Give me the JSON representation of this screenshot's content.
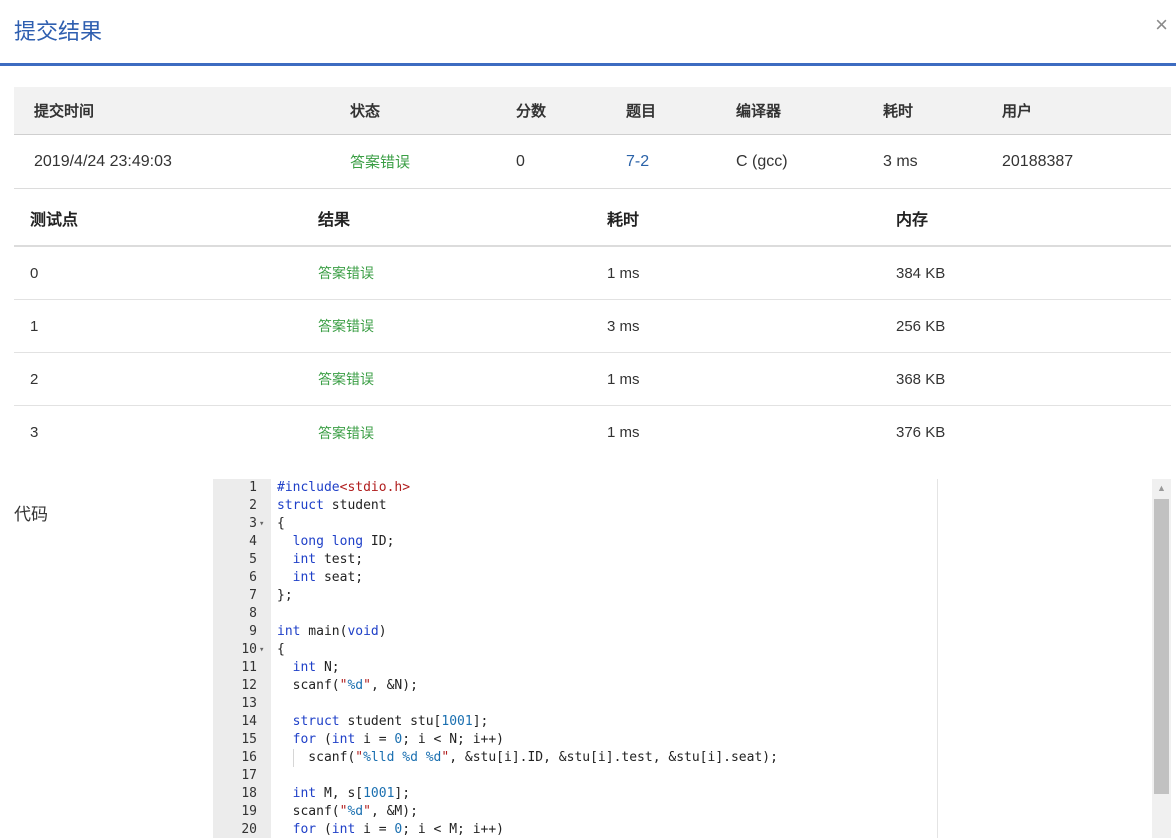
{
  "dialog": {
    "title": "提交结果",
    "close_symbol": "×"
  },
  "summary": {
    "headers": [
      "提交时间",
      "状态",
      "分数",
      "题目",
      "编译器",
      "耗时",
      "用户"
    ],
    "row": {
      "submit_time": "2019/4/24 23:49:03",
      "status": "答案错误",
      "score": "0",
      "problem": "7-2",
      "compiler": "C (gcc)",
      "time": "3 ms",
      "user": "20188387"
    }
  },
  "testcases": {
    "headers": [
      "测试点",
      "结果",
      "耗时",
      "内存"
    ],
    "rows": [
      {
        "id": "0",
        "result": "答案错误",
        "time": "1 ms",
        "memory": "384 KB"
      },
      {
        "id": "1",
        "result": "答案错误",
        "time": "3 ms",
        "memory": "256 KB"
      },
      {
        "id": "2",
        "result": "答案错误",
        "time": "1 ms",
        "memory": "368 KB"
      },
      {
        "id": "3",
        "result": "答案错误",
        "time": "1 ms",
        "memory": "376 KB"
      }
    ]
  },
  "code": {
    "label": "代码",
    "lines": [
      {
        "n": "1",
        "fold": "",
        "guide": false,
        "tokens": [
          {
            "t": "#include",
            "c": "kw"
          },
          {
            "t": "<stdio.h>",
            "c": "str"
          }
        ]
      },
      {
        "n": "2",
        "fold": "",
        "guide": false,
        "tokens": [
          {
            "t": "struct",
            "c": "kw"
          },
          {
            "t": " student",
            "c": ""
          }
        ]
      },
      {
        "n": "3",
        "fold": "▾",
        "guide": false,
        "tokens": [
          {
            "t": "{",
            "c": ""
          }
        ]
      },
      {
        "n": "4",
        "fold": "",
        "guide": false,
        "tokens": [
          {
            "t": "  ",
            "c": ""
          },
          {
            "t": "long",
            "c": "kw"
          },
          {
            "t": " ",
            "c": ""
          },
          {
            "t": "long",
            "c": "kw"
          },
          {
            "t": " ID;",
            "c": ""
          }
        ]
      },
      {
        "n": "5",
        "fold": "",
        "guide": false,
        "tokens": [
          {
            "t": "  ",
            "c": ""
          },
          {
            "t": "int",
            "c": "kw"
          },
          {
            "t": " test;",
            "c": ""
          }
        ]
      },
      {
        "n": "6",
        "fold": "",
        "guide": false,
        "tokens": [
          {
            "t": "  ",
            "c": ""
          },
          {
            "t": "int",
            "c": "kw"
          },
          {
            "t": " seat;",
            "c": ""
          }
        ]
      },
      {
        "n": "7",
        "fold": "",
        "guide": false,
        "tokens": [
          {
            "t": "};",
            "c": ""
          }
        ]
      },
      {
        "n": "8",
        "fold": "",
        "guide": false,
        "tokens": []
      },
      {
        "n": "9",
        "fold": "",
        "guide": false,
        "tokens": [
          {
            "t": "int",
            "c": "kw"
          },
          {
            "t": " main(",
            "c": ""
          },
          {
            "t": "void",
            "c": "kw"
          },
          {
            "t": ")",
            "c": ""
          }
        ]
      },
      {
        "n": "10",
        "fold": "▾",
        "guide": false,
        "tokens": [
          {
            "t": "{",
            "c": ""
          }
        ]
      },
      {
        "n": "11",
        "fold": "",
        "guide": false,
        "tokens": [
          {
            "t": "  ",
            "c": ""
          },
          {
            "t": "int",
            "c": "kw"
          },
          {
            "t": " N;",
            "c": ""
          }
        ]
      },
      {
        "n": "12",
        "fold": "",
        "guide": false,
        "tokens": [
          {
            "t": "  scanf(",
            "c": ""
          },
          {
            "t": "\"",
            "c": "str"
          },
          {
            "t": "%d",
            "c": "fmt"
          },
          {
            "t": "\"",
            "c": "str"
          },
          {
            "t": ", &N);",
            "c": ""
          }
        ]
      },
      {
        "n": "13",
        "fold": "",
        "guide": false,
        "tokens": []
      },
      {
        "n": "14",
        "fold": "",
        "guide": false,
        "tokens": [
          {
            "t": "  ",
            "c": ""
          },
          {
            "t": "struct",
            "c": "kw"
          },
          {
            "t": " student stu[",
            "c": ""
          },
          {
            "t": "1001",
            "c": "num"
          },
          {
            "t": "];",
            "c": ""
          }
        ]
      },
      {
        "n": "15",
        "fold": "",
        "guide": false,
        "tokens": [
          {
            "t": "  ",
            "c": ""
          },
          {
            "t": "for",
            "c": "kw"
          },
          {
            "t": " (",
            "c": ""
          },
          {
            "t": "int",
            "c": "kw"
          },
          {
            "t": " i = ",
            "c": ""
          },
          {
            "t": "0",
            "c": "num"
          },
          {
            "t": "; i < N; i++)",
            "c": ""
          }
        ]
      },
      {
        "n": "16",
        "fold": "",
        "guide": true,
        "tokens": [
          {
            "t": "    scanf(",
            "c": ""
          },
          {
            "t": "\"",
            "c": "str"
          },
          {
            "t": "%lld %d %d",
            "c": "fmt"
          },
          {
            "t": "\"",
            "c": "str"
          },
          {
            "t": ", &stu[i].ID, &stu[i].test, &stu[i].seat);",
            "c": ""
          }
        ]
      },
      {
        "n": "17",
        "fold": "",
        "guide": false,
        "tokens": []
      },
      {
        "n": "18",
        "fold": "",
        "guide": false,
        "tokens": [
          {
            "t": "  ",
            "c": ""
          },
          {
            "t": "int",
            "c": "kw"
          },
          {
            "t": " M, s[",
            "c": ""
          },
          {
            "t": "1001",
            "c": "num"
          },
          {
            "t": "];",
            "c": ""
          }
        ]
      },
      {
        "n": "19",
        "fold": "",
        "guide": false,
        "tokens": [
          {
            "t": "  scanf(",
            "c": ""
          },
          {
            "t": "\"",
            "c": "str"
          },
          {
            "t": "%d",
            "c": "fmt"
          },
          {
            "t": "\"",
            "c": "str"
          },
          {
            "t": ", &M);",
            "c": ""
          }
        ]
      },
      {
        "n": "20",
        "fold": "",
        "guide": false,
        "tokens": [
          {
            "t": "  ",
            "c": ""
          },
          {
            "t": "for",
            "c": "kw"
          },
          {
            "t": " (",
            "c": ""
          },
          {
            "t": "int",
            "c": "kw"
          },
          {
            "t": " i = ",
            "c": ""
          },
          {
            "t": "0",
            "c": "num"
          },
          {
            "t": "; i < M; i++)",
            "c": ""
          }
        ]
      }
    ]
  }
}
